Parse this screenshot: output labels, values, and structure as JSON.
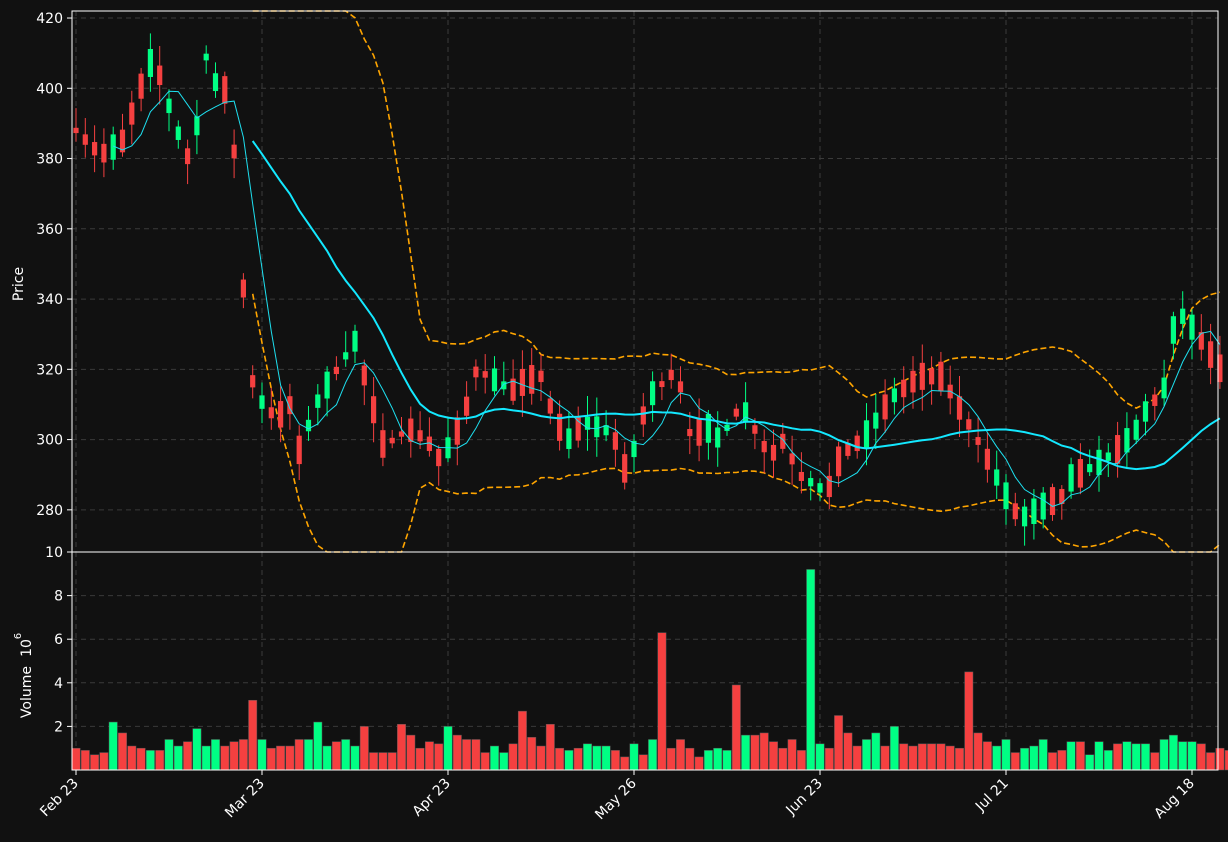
{
  "colors": {
    "background": "#111111",
    "up": "#00ff84",
    "down": "#f54040",
    "grid": "#3a3a3a",
    "axis": "#ffffff",
    "ma_fast": "#1ee0f0",
    "ma_slow": "#13e8ff",
    "band": "#ffa500"
  },
  "chart_data": [
    {
      "type": "candlestick",
      "ylabel": "Price",
      "ylim": [
        268,
        422
      ],
      "yticks": [
        280,
        300,
        320,
        340,
        360,
        380,
        400,
        420
      ],
      "grid": true,
      "xtick_labels": [
        "Feb 23",
        "Mar 23",
        "Apr 23",
        "May 26",
        "Jun 23",
        "Jul 21",
        "Aug 18"
      ],
      "xtick_index": [
        0,
        20,
        40,
        60,
        80,
        100,
        120
      ],
      "n_sessions": 124,
      "overlays": [
        "moving-average-short",
        "moving-average-long",
        "upper-band",
        "lower-band"
      ],
      "price_path": [
        [
          0,
          388
        ],
        [
          7,
          381
        ],
        [
          13,
          385
        ],
        [
          19,
          403
        ],
        [
          22,
          410
        ],
        [
          24,
          401
        ],
        [
          31,
          380
        ],
        [
          34,
          390
        ],
        [
          36,
          410
        ],
        [
          40,
          399
        ],
        [
          43,
          400
        ],
        [
          48,
          325
        ],
        [
          50,
          313
        ],
        [
          56,
          306
        ],
        [
          60,
          310
        ],
        [
          62,
          296
        ],
        [
          68,
          312
        ],
        [
          78,
          328
        ],
        [
          86,
          298
        ],
        [
          93,
          303
        ],
        [
          98,
          300
        ],
        [
          102,
          294
        ],
        [
          108,
          305
        ],
        [
          112,
          320
        ],
        [
          122,
          314
        ],
        [
          124,
          316
        ],
        [
          130,
          318
        ],
        [
          134,
          305
        ],
        [
          138,
          300
        ],
        [
          142,
          305
        ],
        [
          150,
          302
        ],
        [
          154,
          290
        ],
        [
          160,
          312
        ],
        [
          168,
          320
        ],
        [
          172,
          300
        ],
        [
          176,
          304
        ],
        [
          180,
          300
        ],
        [
          186,
          310
        ],
        [
          194,
          295
        ],
        [
          198,
          300
        ],
        [
          202,
          290
        ],
        [
          210,
          285
        ],
        [
          214,
          296
        ],
        [
          220,
          300
        ],
        [
          228,
          312
        ],
        [
          236,
          318
        ],
        [
          242,
          318
        ],
        [
          252,
          300
        ],
        [
          256,
          292
        ],
        [
          262,
          280
        ],
        [
          265,
          278
        ],
        [
          272,
          282
        ],
        [
          276,
          284
        ],
        [
          278,
          289
        ],
        [
          282,
          291
        ],
        [
          290,
          296
        ],
        [
          296,
          302
        ],
        [
          300,
          310
        ],
        [
          304,
          313
        ],
        [
          306,
          330
        ],
        [
          310,
          336
        ],
        [
          312,
          332
        ],
        [
          320,
          320
        ],
        [
          324,
          316
        ]
      ]
    },
    {
      "type": "bar",
      "ylabel": "Volume",
      "ylabel_exponent": "6",
      "ylim": [
        0,
        10
      ],
      "yticks": [
        2,
        4,
        6,
        8,
        10
      ],
      "grid": true,
      "values": [
        1.0,
        0.9,
        0.7,
        0.8,
        2.2,
        1.7,
        1.1,
        1.0,
        0.9,
        0.9,
        1.4,
        1.1,
        1.3,
        1.9,
        1.1,
        1.4,
        1.1,
        1.3,
        1.4,
        3.2,
        1.4,
        1.0,
        1.1,
        1.1,
        1.4,
        1.4,
        2.2,
        1.1,
        1.3,
        1.4,
        1.1,
        2.0,
        0.8,
        0.8,
        0.8,
        2.1,
        1.6,
        1.0,
        1.3,
        1.2,
        2.0,
        1.6,
        1.4,
        1.4,
        0.8,
        1.1,
        0.8,
        1.2,
        2.7,
        1.5,
        1.1,
        2.1,
        1.0,
        0.9,
        1.0,
        1.2,
        1.1,
        1.1,
        0.9,
        0.6,
        1.2,
        0.7,
        1.4,
        6.3,
        1.0,
        1.4,
        1.0,
        0.6,
        0.9,
        1.0,
        0.9,
        3.9,
        1.6,
        1.6,
        1.7,
        1.3,
        1.0,
        1.4,
        0.9,
        9.2,
        1.2,
        1.0,
        2.5,
        1.7,
        1.1,
        1.4,
        1.7,
        1.1,
        2.0,
        1.2,
        1.1,
        1.2,
        1.2,
        1.2,
        1.1,
        1.0,
        4.5,
        1.7,
        1.3,
        1.1,
        1.4,
        0.8,
        1.0,
        1.1,
        1.4,
        0.8,
        0.9,
        1.3,
        1.3,
        0.7,
        1.3,
        0.9,
        1.2,
        1.3,
        1.2,
        1.2,
        0.8,
        1.4,
        1.6,
        1.3,
        1.3,
        1.2,
        0.8,
        1.0,
        0.9,
        0.8
      ],
      "up_days": [
        0,
        0,
        0,
        0,
        1,
        0,
        0,
        0,
        1,
        0,
        1,
        1,
        0,
        1,
        1,
        1,
        0,
        0,
        0,
        0,
        1,
        0,
        0,
        0,
        0,
        1,
        1,
        1,
        0,
        1,
        1,
        0,
        0,
        0,
        0,
        0,
        0,
        0,
        0,
        0,
        1,
        0,
        0,
        0,
        0,
        1,
        1,
        0,
        0,
        0,
        0,
        0,
        0,
        1,
        0,
        1,
        1,
        1,
        0,
        0,
        1,
        0,
        1,
        0,
        0,
        0,
        0,
        0,
        1,
        1,
        1,
        0,
        1,
        0,
        0,
        0,
        0,
        0,
        0,
        1,
        1,
        0,
        0,
        0,
        0,
        1,
        1,
        0,
        1,
        0,
        0,
        0,
        0,
        0,
        0,
        0,
        0,
        0,
        0,
        1,
        1,
        0,
        1,
        1,
        1,
        0,
        0,
        1,
        0,
        1,
        1,
        1,
        0,
        1,
        1,
        1,
        0,
        1,
        1,
        1,
        1,
        0,
        0,
        0,
        0,
        0
      ]
    }
  ]
}
